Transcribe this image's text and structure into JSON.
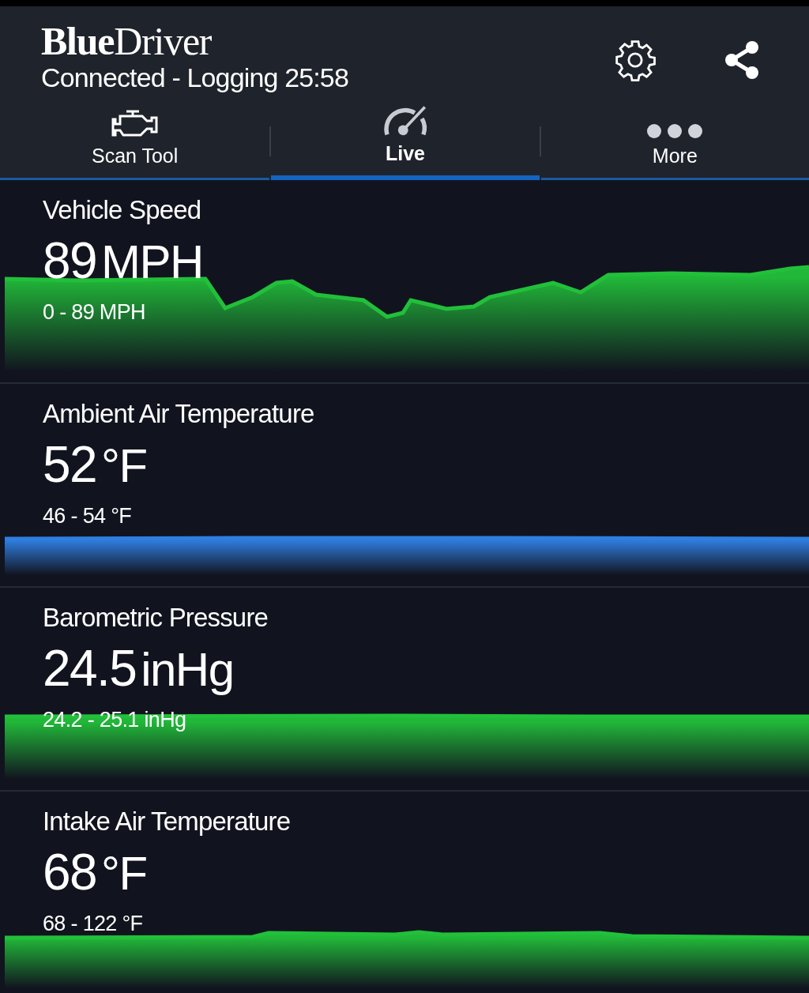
{
  "header": {
    "logo": "**Blue**Driver",
    "status": "Connected - Logging 25:58"
  },
  "tabs": [
    {
      "kind": "engine",
      "label": "Scan Tool",
      "selected": false
    },
    {
      "kind": "gauge",
      "label": "Live",
      "selected": true
    },
    {
      "kind": "dots",
      "label": "More",
      "selected": false
    }
  ],
  "sensors": [
    {
      "name": "Vehicle Speed",
      "value": "89",
      "unit": "MPH",
      "range": "0 - 89 MPH",
      "color": "#22c03a"
    },
    {
      "name": "Ambient Air Temperature",
      "value": "52",
      "unit": "°F",
      "range": "46 - 54 °F",
      "color": "#2f7ee0"
    },
    {
      "name": "Barometric Pressure",
      "value": "24.5",
      "unit": "inHg",
      "range": "24.2 - 25.1 inHg",
      "color": "#22c03a"
    },
    {
      "name": "Intake Air Temperature",
      "value": "68",
      "unit": "°F",
      "range": "68 - 122 °F",
      "color": "#22c03a"
    }
  ]
}
